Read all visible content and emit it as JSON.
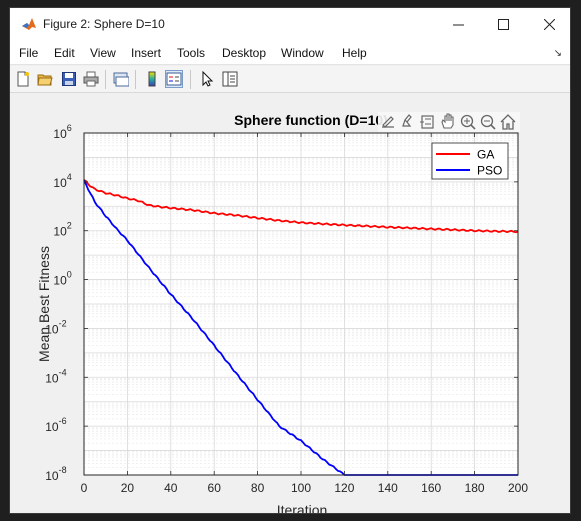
{
  "window": {
    "title": "Figure 2: Sphere D=10"
  },
  "menu": {
    "items": [
      "File",
      "Edit",
      "View",
      "Insert",
      "Tools",
      "Desktop",
      "Window",
      "Help"
    ],
    "arrow": "↘"
  },
  "toolbar": {
    "buttons": [
      "new-figure-icon",
      "open-file-icon",
      "save-icon",
      "print-icon",
      "link-plot-icon",
      "colorbar-icon",
      "legend-icon",
      "pointer-icon",
      "property-editor-icon"
    ]
  },
  "axes_toolbar": {
    "buttons": [
      "export-icon",
      "brush-icon",
      "data-tip-icon",
      "pan-icon",
      "zoom-in-icon",
      "zoom-out-icon",
      "home-icon"
    ]
  },
  "colors": {
    "ga": "#ff0000",
    "pso": "#0000ff",
    "grid": "#d9d9d9"
  },
  "chart_data": {
    "type": "line",
    "title": "Sphere function (D=10)",
    "xlabel": "Iteration",
    "ylabel": "Mean Best Fitness",
    "xlim": [
      0,
      200
    ],
    "ylim": [
      1e-08,
      1000000.0
    ],
    "yscale": "log",
    "xticks": [
      "0",
      "20",
      "40",
      "60",
      "80",
      "100",
      "120",
      "140",
      "160",
      "180",
      "200"
    ],
    "yticks": [
      "10",
      "10",
      "10",
      "10",
      "10",
      "10",
      "10",
      "10"
    ],
    "ytick_exponents": [
      "-8",
      "-6",
      "-4",
      "-2",
      "0",
      "2",
      "4",
      "6"
    ],
    "grid": true,
    "legend_position": "top-right",
    "series": [
      {
        "name": "GA",
        "color": "#ff0000",
        "x": [
          0,
          2,
          5,
          10,
          15,
          20,
          25,
          30,
          35,
          40,
          50,
          60,
          70,
          80,
          90,
          100,
          110,
          120,
          130,
          140,
          150,
          160,
          170,
          180,
          190,
          200
        ],
        "y": [
          12000,
          8000,
          5000,
          3500,
          2800,
          2100,
          1700,
          1100,
          950,
          850,
          700,
          520,
          430,
          330,
          260,
          215,
          190,
          170,
          155,
          140,
          130,
          118,
          110,
          100,
          95,
          92
        ]
      },
      {
        "name": "PSO",
        "color": "#0000ff",
        "x": [
          0,
          2,
          5,
          10,
          15,
          20,
          30,
          40,
          50,
          60,
          70,
          80,
          90,
          100,
          110,
          120,
          130,
          140,
          145,
          150,
          160,
          170,
          175,
          180,
          185,
          190,
          193,
          196,
          200
        ],
        "y": [
          11000,
          5000,
          1500,
          400,
          120,
          40,
          3,
          0.25,
          0.025,
          0.002,
          0.00015,
          1.2e-05,
          1e-06,
          2.5e-07,
          4.5e-08,
          1e-08,
          2.2e-09,
          5.5e-10,
          2.8e-10,
          1.2e-10,
          3e-11,
          9e-12,
          4e-12,
          2.5e-12,
          1.8e-12,
          1.2e-12,
          7e-13,
          4.5e-13,
          3e-13
        ]
      }
    ]
  }
}
